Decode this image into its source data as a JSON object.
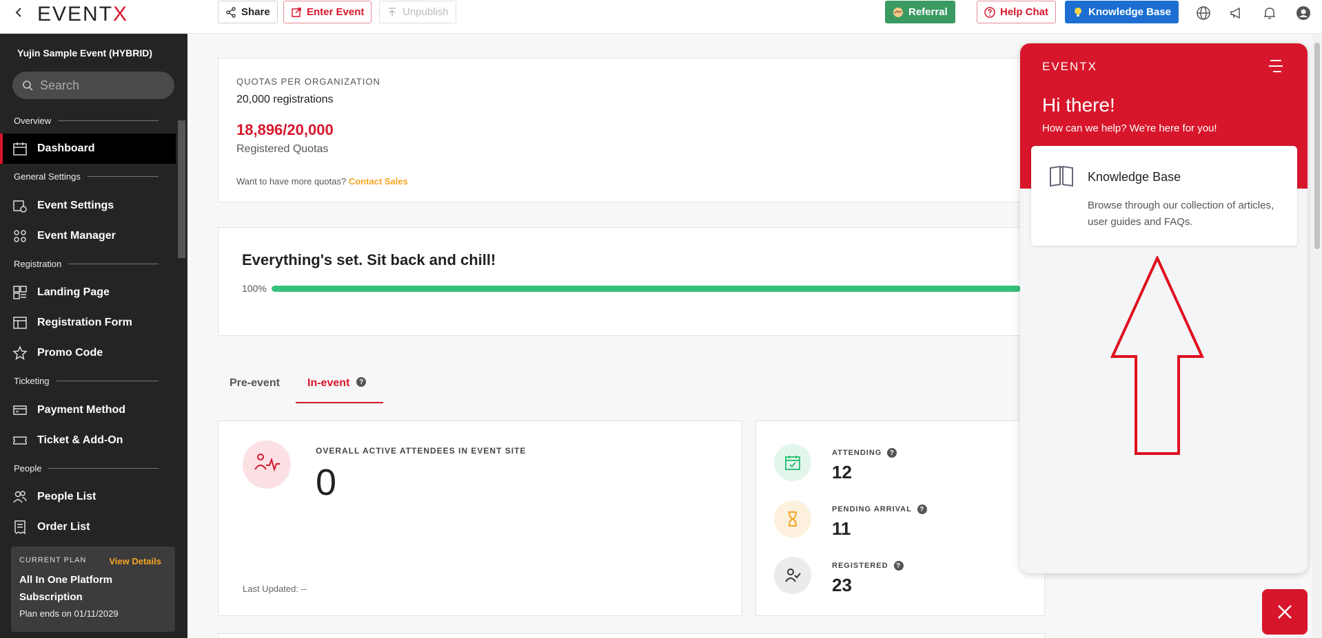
{
  "topbar": {
    "logo": "EVENTX",
    "share": "Share",
    "enter_event": "Enter Event",
    "unpublish": "Unpublish",
    "referral": "Referral",
    "help_chat": "Help Chat",
    "knowledge_base": "Knowledge Base"
  },
  "sidebar": {
    "event_name": "Yujin Sample Event (HYBRID)",
    "search_placeholder": "Search",
    "sections": {
      "overview": "Overview",
      "general": "General Settings",
      "registration": "Registration",
      "ticketing": "Ticketing",
      "people": "People"
    },
    "items": {
      "dashboard": "Dashboard",
      "event_settings": "Event Settings",
      "event_manager": "Event Manager",
      "landing_page": "Landing Page",
      "registration_form": "Registration Form",
      "promo_code": "Promo Code",
      "payment_method": "Payment Method",
      "ticket_addon": "Ticket & Add-On",
      "people_list": "People List",
      "order_list": "Order List"
    },
    "plan": {
      "label": "CURRENT PLAN",
      "view": "View Details",
      "name": "All In One Platform Subscription",
      "ends": "Plan ends on 01/11/2029"
    }
  },
  "quota": {
    "title": "QUOTAS PER ORGANIZATION",
    "registrations": "20,000 registrations",
    "used": "18,896/20,000",
    "used_label": "Registered Quotas",
    "more": "Want to have more quotas?",
    "contact": "Contact Sales"
  },
  "progress": {
    "title": "Everything's set. Sit back and chill!",
    "percent_label": "100%",
    "value": 100
  },
  "tabs": {
    "pre": "Pre-event",
    "in": "In-event"
  },
  "active": {
    "label": "OVERALL ACTIVE ATTENDEES IN EVENT SITE",
    "value": "0",
    "updated": "Last Updated: --"
  },
  "stats": {
    "attending_label": "ATTENDING",
    "attending": "12",
    "pending_label": "PENDING ARRIVAL",
    "pending": "11",
    "registered_label": "REGISTERED",
    "registered": "23"
  },
  "help": {
    "logo": "EVENTX",
    "hi": "Hi there!",
    "sub": "How can we help? We're here for you!",
    "kb_title": "Knowledge Base",
    "kb_desc": "Browse through our collection of articles, user guides and FAQs."
  },
  "colors": {
    "brand": "#d7162b",
    "progress": "#34c179",
    "accent": "#f5a623"
  }
}
